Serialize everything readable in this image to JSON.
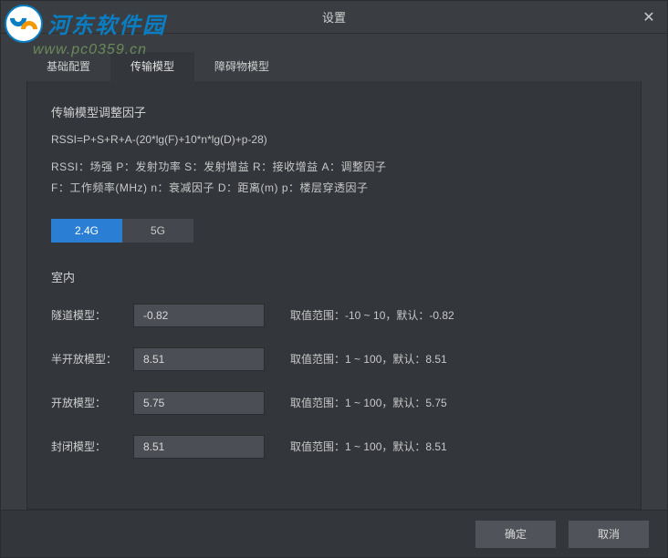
{
  "watermark": {
    "text": "河东软件园",
    "url": "www.pc0359.cn"
  },
  "dialog": {
    "title": "设置",
    "close_icon": "✕"
  },
  "tabs": [
    {
      "label": "基础配置",
      "active": false
    },
    {
      "label": "传输模型",
      "active": true
    },
    {
      "label": "障碍物模型",
      "active": false
    }
  ],
  "panel": {
    "section_title": "传输模型调整因子",
    "formula": "RSSI=P+S+R+A-(20*lg(F)+10*n*lg(D)+p-28)",
    "legend_line1": "RSSI：场强  P：发射功率  S：发射增益  R：接收增益  A：调整因子",
    "legend_line2": "F：工作频率(MHz)  n：衰减因子  D：距离(m)  p：楼层穿透因子",
    "bands": [
      {
        "label": "2.4G",
        "active": true
      },
      {
        "label": "5G",
        "active": false
      }
    ],
    "indoor_title": "室内",
    "rows": [
      {
        "label": "隧道模型：",
        "value": "-0.82",
        "hint": "取值范围：-10 ~ 10，默认：-0.82"
      },
      {
        "label": "半开放模型：",
        "value": "8.51",
        "hint": "取值范围：1 ~ 100，默认：8.51"
      },
      {
        "label": "开放模型：",
        "value": "5.75",
        "hint": "取值范围：1 ~ 100，默认：5.75"
      },
      {
        "label": "封闭模型：",
        "value": "8.51",
        "hint": "取值范围：1 ~ 100，默认：8.51"
      }
    ]
  },
  "footer": {
    "ok_label": "确定",
    "cancel_label": "取消"
  }
}
